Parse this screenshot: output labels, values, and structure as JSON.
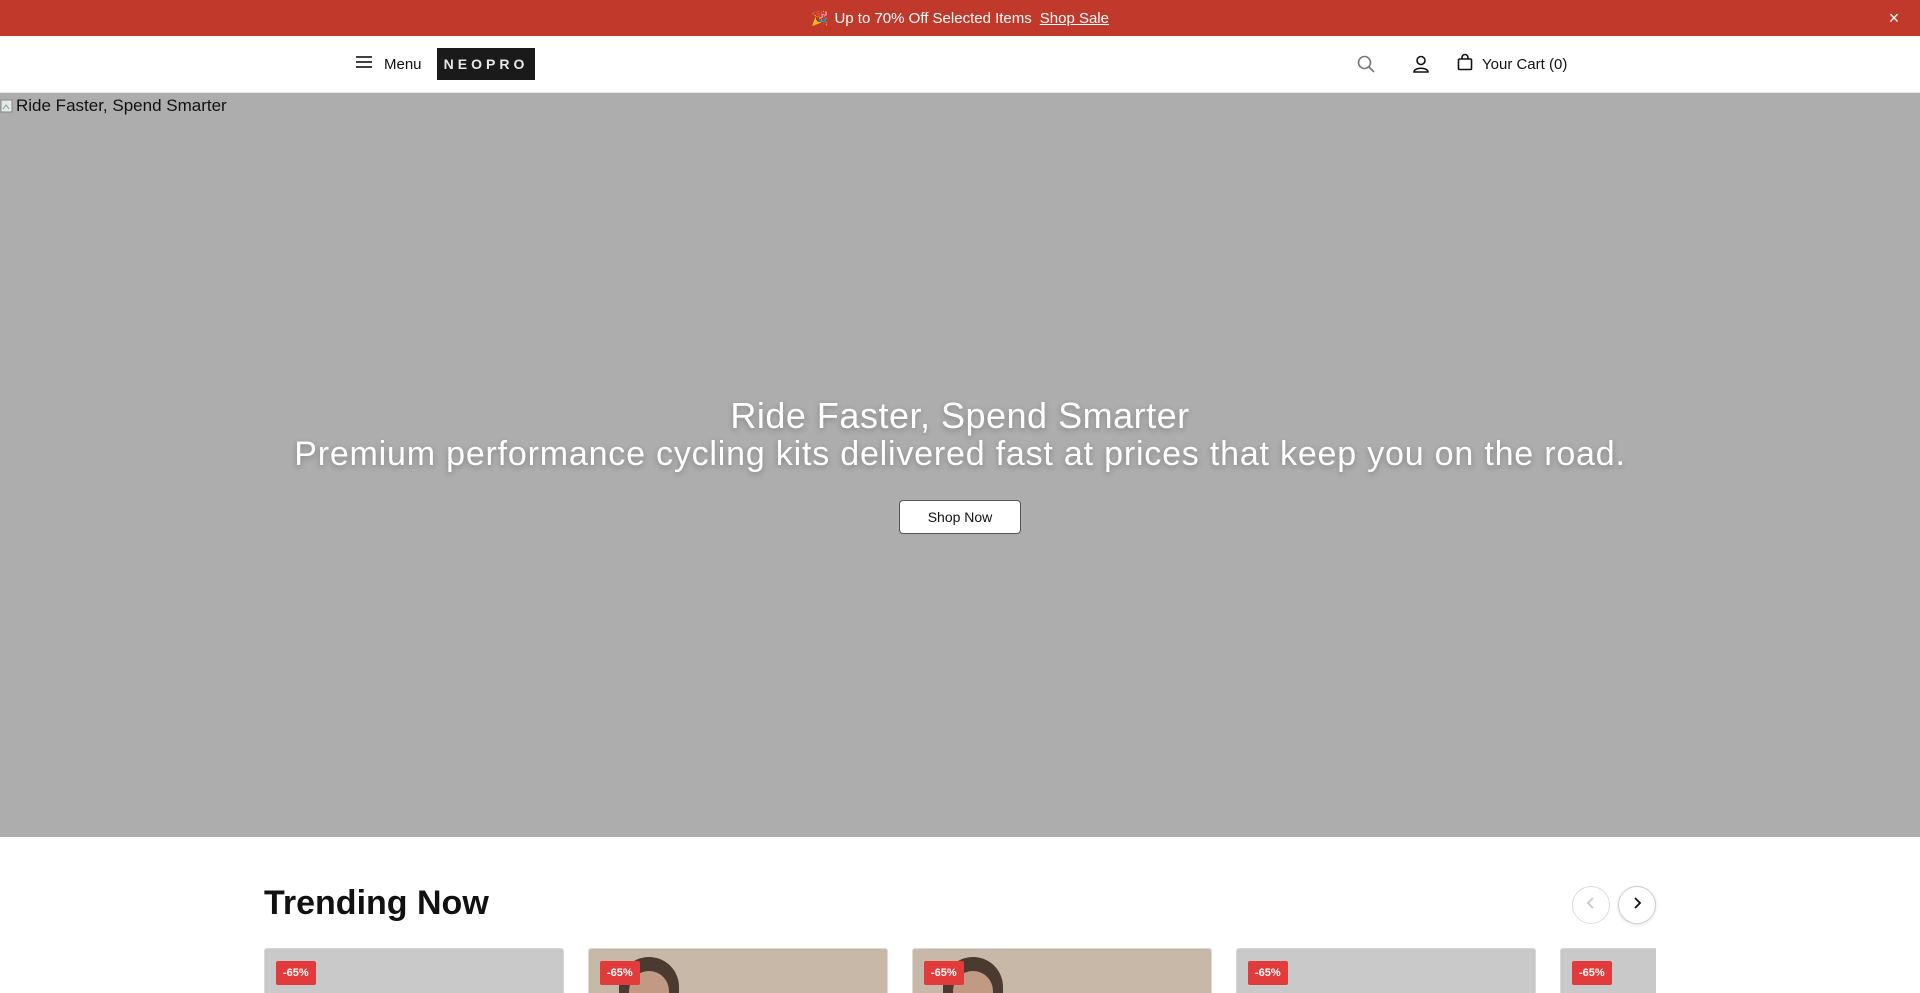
{
  "announcement": {
    "emoji": "🎉",
    "text": "Up to 70% Off Selected Items",
    "link_label": "Shop Sale",
    "close_label": "×",
    "background": "#c0392b"
  },
  "header": {
    "menu_label": "Menu",
    "logo_text": "NEOPRO",
    "cart_label": "Your Cart (0)",
    "icons": [
      "hamburger-icon",
      "search-icon",
      "user-icon",
      "shopping-bag-icon"
    ]
  },
  "hero": {
    "image_alt": "Ride Faster, Spend Smarter",
    "title": "Ride Faster, Spend Smarter",
    "subtitle": "Premium performance cycling kits delivered fast at prices that keep you on the road.",
    "cta_label": "Shop Now",
    "background": "#adadad"
  },
  "trending": {
    "title": "Trending Now",
    "products": [
      {
        "badge": "-65%",
        "image": "grey-placeholder"
      },
      {
        "badge": "-65%",
        "image": "model-photo"
      },
      {
        "badge": "-65%",
        "image": "model-photo"
      },
      {
        "badge": "-65%",
        "image": "grey-placeholder"
      },
      {
        "badge": "-65%",
        "image": "grey-placeholder"
      }
    ],
    "badge_color": "#e23b3b"
  }
}
